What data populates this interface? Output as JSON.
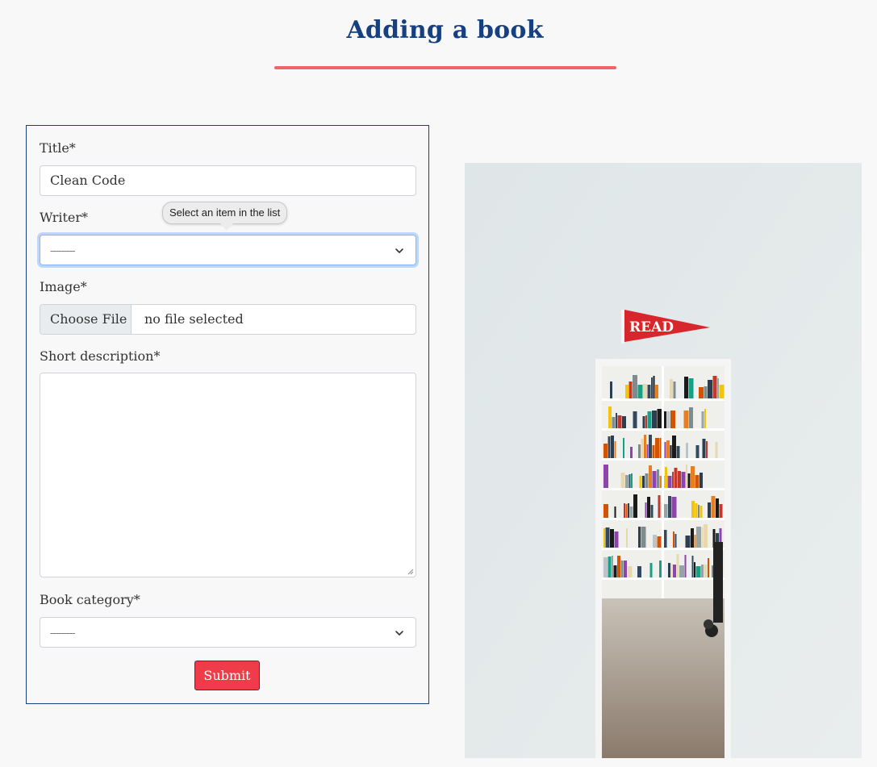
{
  "header": {
    "title": "Adding a book"
  },
  "form": {
    "title_label": "Title*",
    "title_value": "Clean Code",
    "writer_label": "Writer*",
    "writer_value": "---------",
    "image_label": "Image*",
    "choose_file_label": "Choose File",
    "file_status": "no file selected",
    "description_label": "Short description*",
    "description_value": "",
    "category_label": "Book category*",
    "category_value": "---------",
    "submit_label": "Submit"
  },
  "tooltip": {
    "text": "Select an item in the list"
  },
  "photo": {
    "sign_text": "READ"
  },
  "colors": {
    "accent": "#f03c48",
    "heading": "#16407f",
    "underline": "#f0646c"
  }
}
